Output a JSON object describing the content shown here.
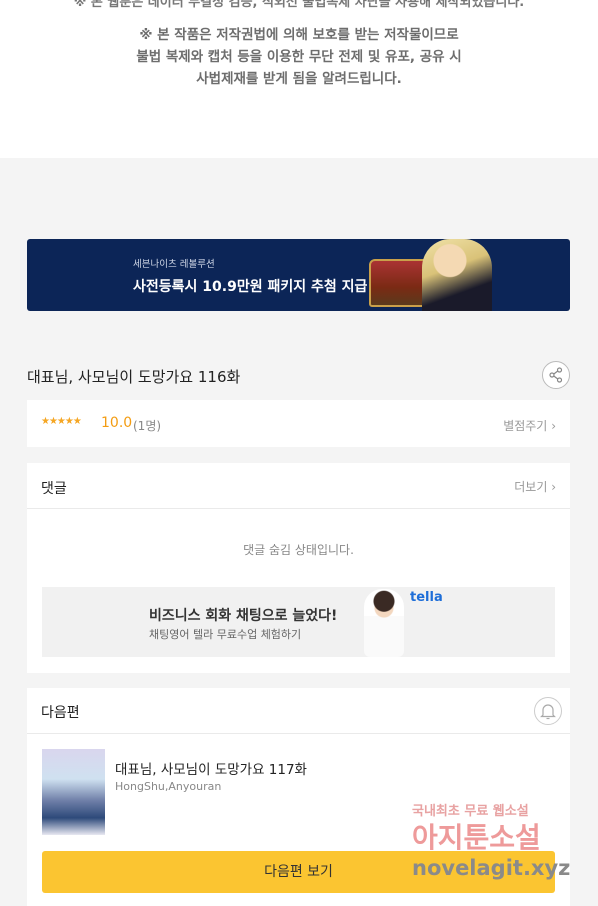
{
  "notice": {
    "partial_top": "※ 본 웹툰은 데이터 무결성 검증, 적외선 불법복제 차단을 사용해 제작되었습니다.",
    "line1": "※ 본 작품은 저작권법에 의해 보호를 받는 저작물이므로",
    "line2": "불법 복제와 캡처 등을 이용한 무단 전제 및 유포, 공유 시",
    "line3": "사법제재를 받게 됨을 알려드립니다."
  },
  "banner": {
    "subtitle": "세븐나이츠 레볼루션",
    "title": "사전등록시 10.9만원 패키지 추첨 지급"
  },
  "episode": {
    "title": "대표님, 사모님이 도망가요 116화"
  },
  "rating": {
    "stars": "★★★★★",
    "score": "10.0",
    "count": "(1명)",
    "rate_label": "별점주기"
  },
  "comments": {
    "header": "댓글",
    "more_label": "더보기",
    "hidden_message": "댓글 숨김 상태입니다."
  },
  "ad": {
    "headline": "비즈니스 회화 채팅으로 늘었다!",
    "subline": "채팅영어 텔라 무료수업 체험하기",
    "logo": "tella"
  },
  "next": {
    "header": "다음편",
    "title": "대표님, 사모님이 도망가요 117화",
    "author": "HongShu,Anyouran",
    "button": "다음편 보기"
  },
  "watermark": {
    "line1": "국내최초 무료 웹소설",
    "line2": "아지툰소설",
    "line3": "novelagit.xyz"
  },
  "icons": {
    "share": "share-icon",
    "bell": "bell-icon",
    "chevron": "chevron-right-icon"
  },
  "colors": {
    "accent": "#fbc531",
    "banner_bg": "#0c2557",
    "star": "#f5a623",
    "tella": "#1e6ed8"
  }
}
